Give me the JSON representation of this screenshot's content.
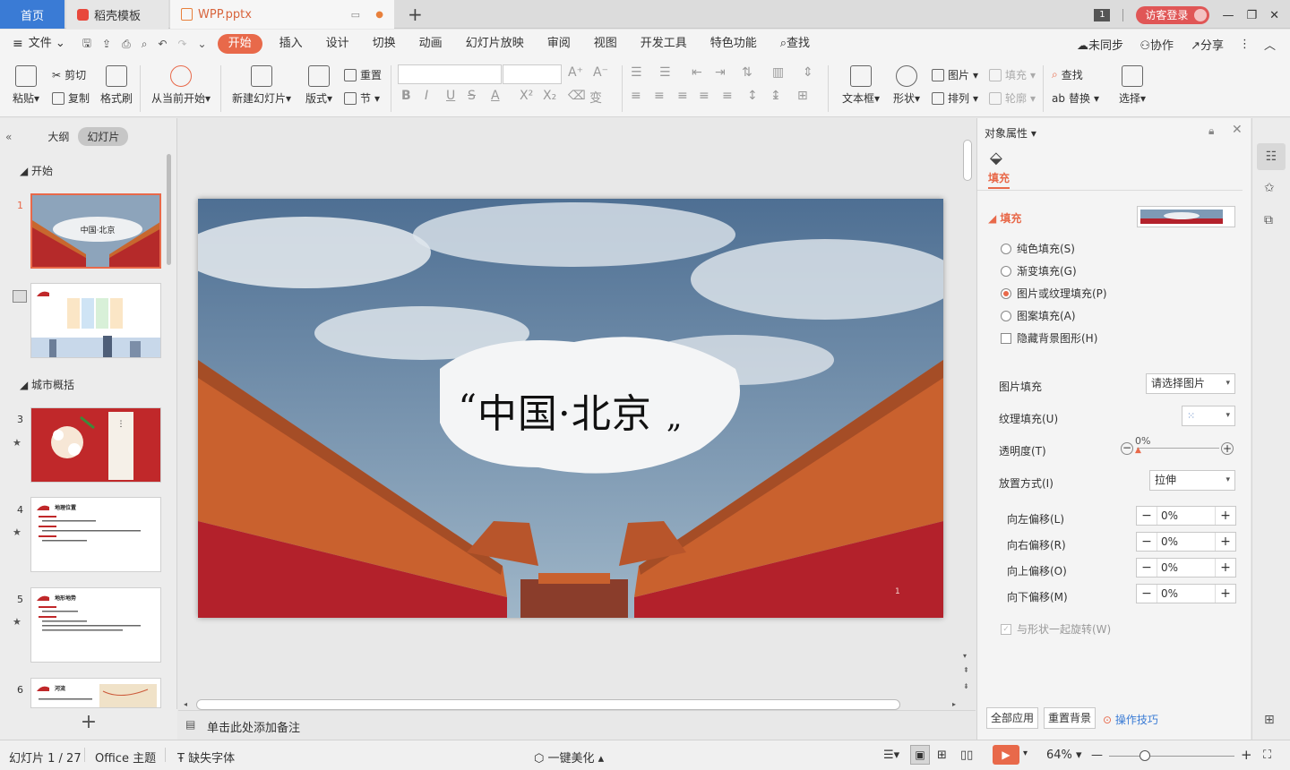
{
  "tabs": {
    "home": "首页",
    "docer": "稻壳模板",
    "file": "WPP.pptx",
    "file_count_badge": "1",
    "login": "访客登录"
  },
  "menu": {
    "file": "文件",
    "items": [
      "开始",
      "插入",
      "设计",
      "切换",
      "动画",
      "幻灯片放映",
      "审阅",
      "视图",
      "开发工具",
      "特色功能"
    ],
    "search": "查找",
    "unsynced": "未同步",
    "collab": "协作",
    "share": "分享"
  },
  "ribbon": {
    "paste": "粘贴",
    "cut": "剪切",
    "copy": "复制",
    "format_painter": "格式刷",
    "from_current": "从当前开始",
    "new_slide": "新建幻灯片",
    "layout": "版式",
    "reset": "重置",
    "section": "节",
    "textbox": "文本框",
    "shape": "形状",
    "picture": "图片",
    "arrange": "排列",
    "fill": "填充",
    "outline": "轮廓",
    "find": "查找",
    "replace": "替换",
    "select": "选择"
  },
  "left_pane": {
    "tab_outline": "大纲",
    "tab_slides": "幻灯片",
    "section1": "开始",
    "section2": "城市概括",
    "slide_numbers": [
      "1",
      "3",
      "4",
      "5",
      "6"
    ],
    "thumb1_title": "中国·北京",
    "thumb4_title": "地理位置",
    "thumb5_title": "地形地势",
    "thumb6_title": "河流"
  },
  "slide": {
    "title": "中国·北京",
    "open_quote": "“",
    "close_quote": "„",
    "page_number": "1"
  },
  "notes_placeholder": "单击此处添加备注",
  "right_pane": {
    "title": "对象属性",
    "tab": "填充",
    "section": "填充",
    "options": [
      "纯色填充(S)",
      "渐变填充(G)",
      "图片或纹理填充(P)",
      "图案填充(A)"
    ],
    "selected_option": "图片或纹理填充(P)",
    "hide_bg": "隐藏背景图形(H)",
    "picture_fill_label": "图片填充",
    "picture_fill_value": "请选择图片",
    "texture_fill_label": "纹理填充(U)",
    "transparency_label": "透明度(T)",
    "transparency_value": "0%",
    "placement_label": "放置方式(I)",
    "placement_value": "拉伸",
    "offset_left_label": "向左偏移(L)",
    "offset_right_label": "向右偏移(R)",
    "offset_up_label": "向上偏移(O)",
    "offset_down_label": "向下偏移(M)",
    "offset_left": "0%",
    "offset_right": "0%",
    "offset_up": "0%",
    "offset_down": "0%",
    "rotate_with_shape": "与形状一起旋转(W)",
    "apply_all": "全部应用",
    "reset_bg": "重置背景",
    "tips": "操作技巧"
  },
  "status": {
    "slide_info": "幻灯片 1 / 27",
    "theme": "Office 主题",
    "missing_fonts": "缺失字体",
    "beautify": "一键美化",
    "zoom": "64%"
  },
  "colors": {
    "accent": "#e8694a",
    "home_tab": "#3a7bd5",
    "wall_red": "#b3212b",
    "roof_orange": "#c9612e"
  }
}
